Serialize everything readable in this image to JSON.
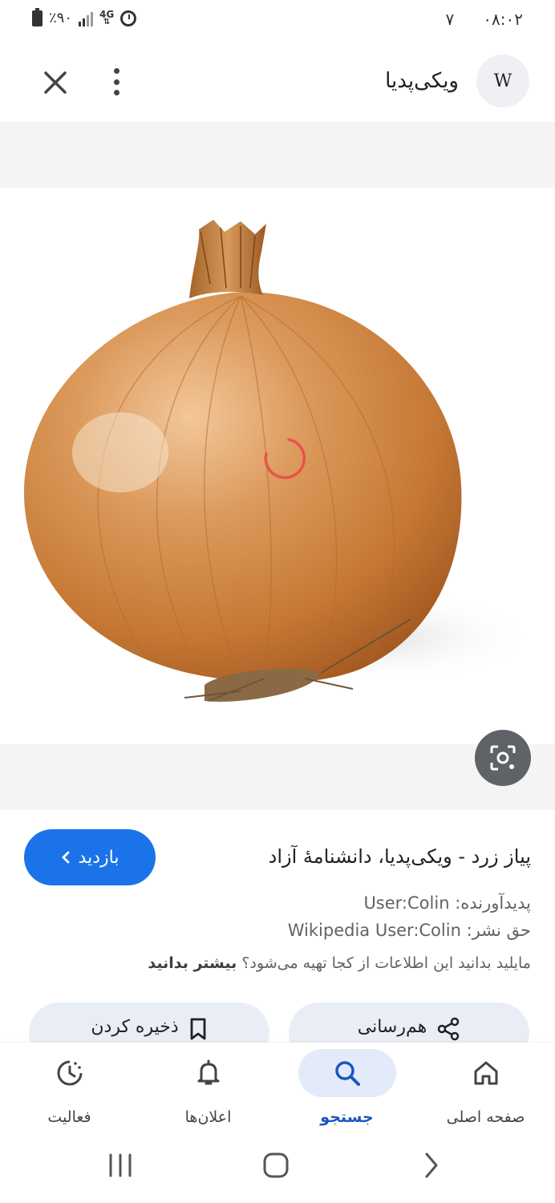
{
  "status_bar": {
    "battery": "٪۹۰",
    "network": "4G",
    "notification": "۷",
    "time": "۰۸:۰۲"
  },
  "header": {
    "site_name": "ویکی‌پدیا",
    "logo_letter": "W",
    "icons": [
      "wikipedia-logo-icon",
      "more-vertical-icon",
      "close-icon"
    ]
  },
  "image": {
    "subject": "onion",
    "loading": true
  },
  "result": {
    "visit_label": "بازدید",
    "title": "پیاز زرد - ویکی‌پدیا، دانشنامهٔ آزاد",
    "creator_label": "پدیدآورنده:",
    "creator_value": "User:Colin",
    "copyright_label": "حق نشر:",
    "copyright_value": "Wikipedia User:Colin",
    "info_text": "مایلید بدانید این اطلاعات از کجا تهیه می‌شود؟",
    "learn_more": "بیشتر بدانید",
    "share_label": "هم‌رسانی",
    "save_label": "ذخیره کردن"
  },
  "bottom_nav": {
    "items": [
      {
        "label": "صفحه اصلی",
        "icon": "home-icon",
        "active": false
      },
      {
        "label": "جستجو",
        "icon": "search-icon",
        "active": true
      },
      {
        "label": "اعلان‌ها",
        "icon": "bell-icon",
        "active": false
      },
      {
        "label": "فعالیت",
        "icon": "activity-icon",
        "active": false
      }
    ]
  },
  "colors": {
    "accent": "#1a73e8",
    "nav_active_bg": "#e3ebfb",
    "pill_bg": "#e9eef6",
    "spinner": "#ea4335"
  }
}
